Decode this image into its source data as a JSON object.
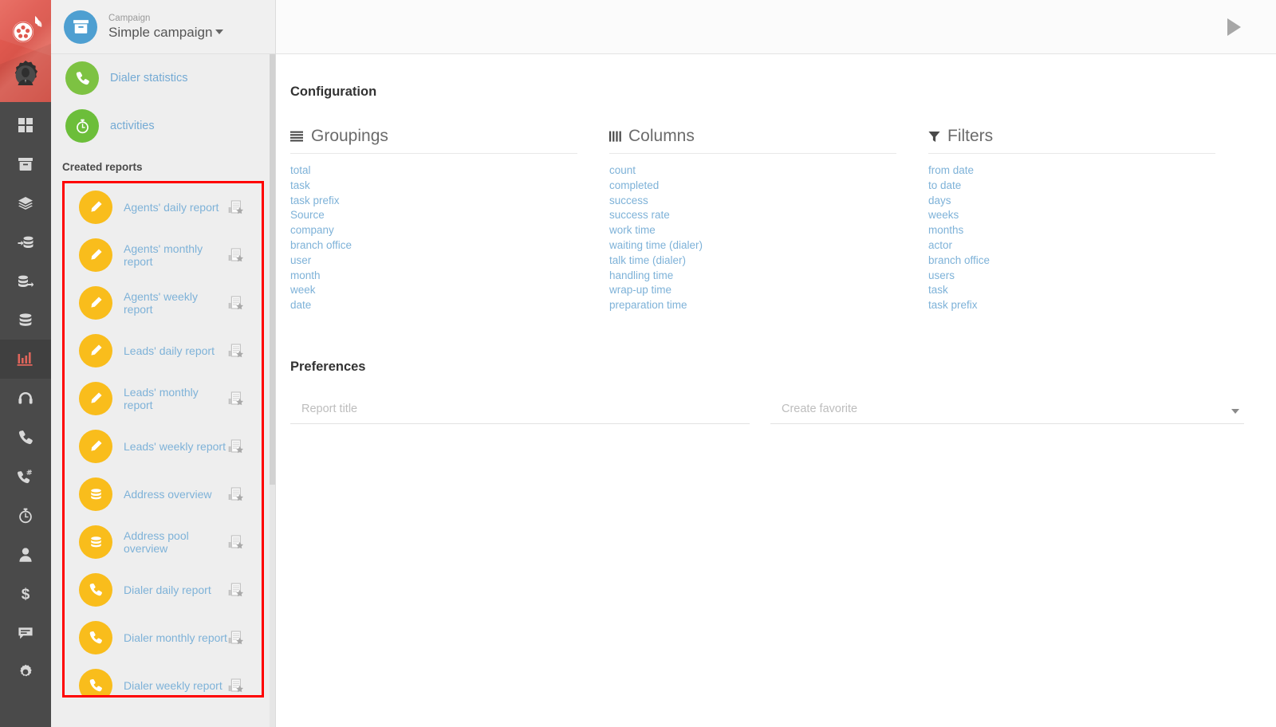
{
  "rail": {
    "logo": {
      "name": "comet-logo-icon",
      "gear": "gear-user-icon"
    },
    "items": [
      {
        "icon": "dashboard-grid-icon",
        "name": "rail-item-dashboard",
        "active": false
      },
      {
        "icon": "archive-box-icon",
        "name": "rail-item-archive",
        "active": false
      },
      {
        "icon": "layers-icon",
        "name": "rail-item-layers",
        "active": false
      },
      {
        "icon": "database-import-icon",
        "name": "rail-item-import",
        "active": false
      },
      {
        "icon": "database-export-icon",
        "name": "rail-item-export",
        "active": false
      },
      {
        "icon": "database-icon",
        "name": "rail-item-database",
        "active": false
      },
      {
        "icon": "bar-chart-icon",
        "name": "rail-item-reports",
        "active": true
      },
      {
        "icon": "headset-icon",
        "name": "rail-item-headset",
        "active": false
      },
      {
        "icon": "phone-icon",
        "name": "rail-item-phone",
        "active": false
      },
      {
        "icon": "phone-keypad-icon",
        "name": "rail-item-dialer",
        "active": false
      },
      {
        "icon": "stopwatch-icon",
        "name": "rail-item-activities",
        "active": false
      },
      {
        "icon": "user-icon",
        "name": "rail-item-user",
        "active": false
      },
      {
        "icon": "dollar-icon",
        "name": "rail-item-billing",
        "active": false
      },
      {
        "icon": "chat-icon",
        "name": "rail-item-chat",
        "active": false
      },
      {
        "icon": "gear-icon",
        "name": "rail-item-settings",
        "active": false
      }
    ]
  },
  "sidebar": {
    "campaign_label": "Campaign",
    "campaign_name": "Simple campaign",
    "campaign_icon": "archive-box-icon",
    "links": [
      {
        "label": "Dialer statistics",
        "icon": "phone-icon",
        "color": "green"
      },
      {
        "label": "activities",
        "icon": "stopwatch-icon",
        "color": "green2"
      }
    ],
    "created_reports_title": "Created reports",
    "reports": [
      {
        "label": "Agents' daily report",
        "icon": "pencil-icon"
      },
      {
        "label": "Agents' monthly report",
        "icon": "pencil-icon"
      },
      {
        "label": "Agents' weekly report",
        "icon": "pencil-icon"
      },
      {
        "label": "Leads' daily report",
        "icon": "pencil-icon"
      },
      {
        "label": "Leads' monthly report",
        "icon": "pencil-icon"
      },
      {
        "label": "Leads' weekly report",
        "icon": "pencil-icon"
      },
      {
        "label": "Address overview",
        "icon": "database-icon"
      },
      {
        "label": "Address pool overview",
        "icon": "database-icon"
      },
      {
        "label": "Dialer daily report",
        "icon": "phone-icon"
      },
      {
        "label": "Dialer monthly report",
        "icon": "phone-icon"
      },
      {
        "label": "Dialer weekly report",
        "icon": "phone-icon"
      }
    ],
    "favorite_icon": "report-favorite-icon",
    "highlight_color": "#ff0000"
  },
  "topbar": {
    "play_icon": "play-icon"
  },
  "main": {
    "configuration_title": "Configuration",
    "groups": [
      {
        "title": "Groupings",
        "icon": "list-icon",
        "items": [
          "total",
          "task",
          "task prefix",
          "Source",
          "company",
          "branch office",
          "user",
          "month",
          "week",
          "date"
        ]
      },
      {
        "title": "Columns",
        "icon": "columns-icon",
        "items": [
          "count",
          "completed",
          "success",
          "success rate",
          "work time",
          "waiting time (dialer)",
          "talk time (dialer)",
          "handling time",
          "wrap-up time",
          "preparation time"
        ]
      },
      {
        "title": "Filters",
        "icon": "funnel-icon",
        "items": [
          "from date",
          "to date",
          "days",
          "weeks",
          "months",
          "actor",
          "branch office",
          "users",
          "task",
          "task prefix"
        ]
      }
    ],
    "preferences_title": "Preferences",
    "report_title_placeholder": "Report title",
    "report_title_value": "",
    "create_favorite_placeholder": "Create favorite",
    "create_favorite_value": ""
  },
  "colors": {
    "link_blue": "#7eb2d8",
    "accent_red": "#e0655b",
    "yellow": "#f9bd1c",
    "green": "#7dc242",
    "blue": "#4e9fd1"
  }
}
